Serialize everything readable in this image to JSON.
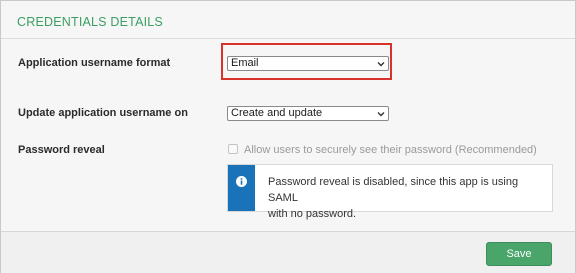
{
  "section": {
    "title": "CREDENTIALS DETAILS"
  },
  "fields": {
    "username_format": {
      "label": "Application username format",
      "value": "Email"
    },
    "update_on": {
      "label": "Update application username on",
      "value": "Create and update"
    },
    "password_reveal": {
      "label": "Password reveal",
      "checkbox_label": "Allow users to securely see their password (Recommended)",
      "checked": false
    }
  },
  "info": {
    "line1": "Password reveal is disabled, since this app is using SAML",
    "line2": "with no password."
  },
  "footer": {
    "save_label": "Save"
  },
  "colors": {
    "accent_green": "#3a9e63",
    "save_button": "#4aa56b",
    "info_blue": "#1a73b8",
    "highlight_red": "#d9322a"
  }
}
